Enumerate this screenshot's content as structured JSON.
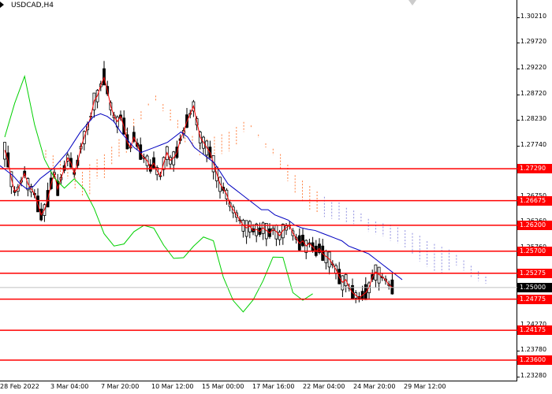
{
  "title": "USDCAD,H4",
  "price_ticks": [
    "1.30210",
    "1.29720",
    "1.29220",
    "1.28720",
    "1.28230",
    "1.27740",
    "1.27240",
    "1.26750",
    "1.26260",
    "1.25760",
    "1.25270",
    "1.24770",
    "1.24270",
    "1.23780",
    "1.23280"
  ],
  "levels": [
    "1.27290",
    "1.26675",
    "1.26200",
    "1.25700",
    "1.25275",
    "1.24775",
    "1.24175",
    "1.23600"
  ],
  "current_price": "1.25000",
  "time_labels": [
    "28 Feb 2022",
    "3 Mar 04:00",
    "7 Mar 20:00",
    "10 Mar 12:00",
    "15 Mar 00:00",
    "17 Mar 16:00",
    "22 Mar 04:00",
    "24 Mar 20:00",
    "29 Mar 12:00"
  ],
  "colors": {
    "level_line": "#ff0000",
    "tenkan": "#ff0000",
    "kijun": "#0000c0",
    "chikou": "#00d000",
    "senkou_a": "#ff8040",
    "senkou_b": "#9090e0",
    "candle": "#000000"
  },
  "icons": {
    "caret": "caret-right-icon"
  },
  "chart_data": {
    "type": "line",
    "ylim": [
      1.2328,
      1.3045
    ],
    "series": [
      {
        "values": [
          1.2765,
          1.2745,
          1.271,
          1.2685,
          1.269,
          1.2705,
          1.272,
          1.27,
          1.269,
          1.268,
          1.266,
          1.264,
          1.265,
          1.267,
          1.27,
          1.272,
          1.269,
          1.271,
          1.273,
          1.275,
          1.274,
          1.272,
          1.274,
          1.277,
          1.279,
          1.281,
          1.283,
          1.286,
          1.287,
          1.289,
          1.2905,
          1.288,
          1.285,
          1.283,
          1.282,
          1.283,
          1.281,
          1.278,
          1.277,
          1.279,
          1.2775,
          1.276,
          1.275,
          1.2745,
          1.273,
          1.274,
          1.2725,
          1.2715,
          1.274,
          1.276,
          1.2745,
          1.275,
          1.276,
          1.2785,
          1.28,
          1.282,
          1.2835,
          1.285,
          1.282,
          1.279,
          1.278,
          1.277,
          1.276,
          1.274,
          1.272,
          1.27,
          1.269,
          1.268,
          1.266,
          1.265,
          1.264,
          1.263,
          1.262,
          1.2615,
          1.2618,
          1.261,
          1.2612,
          1.2608,
          1.2615,
          1.261,
          1.2605,
          1.2612,
          1.2608,
          1.26,
          1.261,
          1.2615,
          1.262,
          1.2605,
          1.2595,
          1.2585,
          1.259,
          1.258,
          1.2585,
          1.2578,
          1.257,
          1.2575,
          1.2565,
          1.256,
          1.2555,
          1.2545,
          1.2535,
          1.252,
          1.251,
          1.2515,
          1.25,
          1.249,
          1.2485,
          1.248,
          1.2485,
          1.249,
          1.25,
          1.252,
          1.253,
          1.2525,
          1.252,
          1.2515,
          1.2505,
          1.25
        ]
      },
      {
        "values": [
          1.2735,
          1.2725,
          1.2715,
          1.27,
          1.269,
          1.2695,
          1.271,
          1.272,
          1.273,
          1.2745,
          1.276,
          1.278,
          1.28,
          1.2815,
          1.283,
          1.2835,
          1.283,
          1.282,
          1.28,
          1.2785,
          1.277,
          1.276,
          1.2765,
          1.277,
          1.2775,
          1.278,
          1.279,
          1.28,
          1.279,
          1.277,
          1.276,
          1.275,
          1.274,
          1.272,
          1.27,
          1.269,
          1.268,
          1.267,
          1.266,
          1.265,
          1.265,
          1.264,
          1.2635,
          1.263,
          1.262,
          1.2615,
          1.2612,
          1.261,
          1.2605,
          1.26,
          1.2595,
          1.259,
          1.258,
          1.2575,
          1.257,
          1.2565,
          1.2555,
          1.2545,
          1.2535,
          1.2525,
          1.2515
        ]
      },
      {
        "values": [
          1.279,
          1.283,
          1.288,
          1.281,
          1.277,
          1.274,
          1.27,
          1.269,
          1.266,
          1.264,
          1.262,
          1.261,
          1.26,
          1.2595,
          1.259,
          1.2595,
          1.259,
          1.2585,
          1.258,
          1.2575,
          1.257,
          1.2565,
          1.252,
          1.25,
          1.248,
          1.248,
          1.249,
          1.253,
          1.255,
          1.251,
          1.2505,
          1.25
        ]
      }
    ]
  }
}
